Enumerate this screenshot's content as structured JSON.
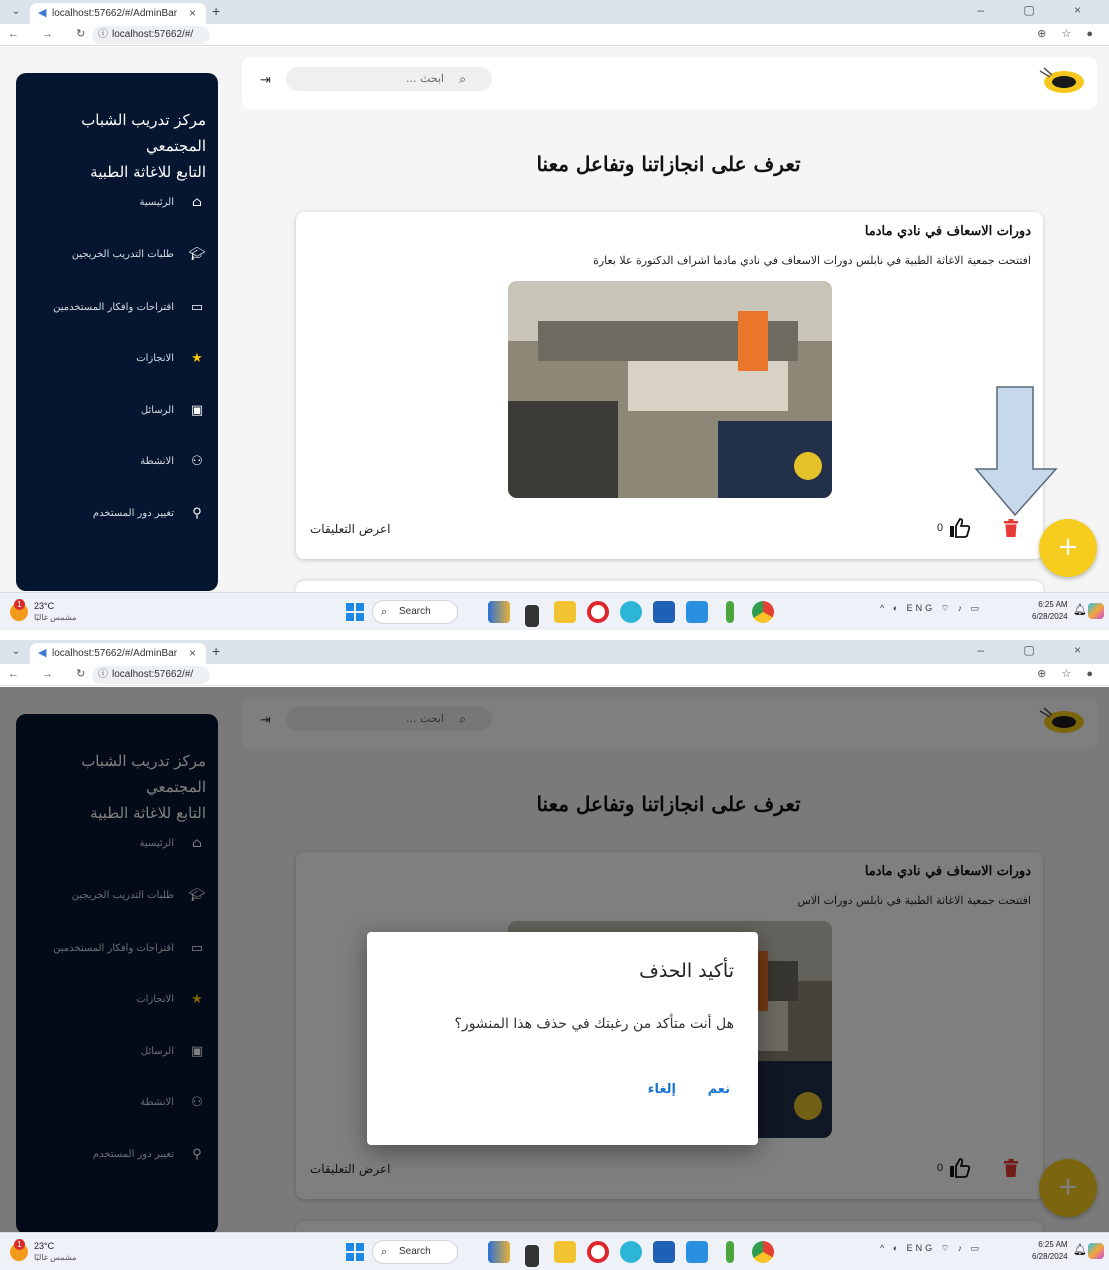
{
  "browser": {
    "tab_title_1": "localhost:57662/#/AdminBar",
    "tab_title_2": "localhost:57662/#/AdminBar",
    "url": "localhost:57662/#/"
  },
  "sidebar": {
    "brand_line1": "مركز تدريب الشباب المجتمعي",
    "brand_line2": "التابع للاغاثة الطبية",
    "items": [
      {
        "label": "الرئيسية",
        "icon": "home-icon"
      },
      {
        "label": "طلبات التدريب الخريجين",
        "icon": "graduation-cap-icon"
      },
      {
        "label": "اقتراحات وافكار المستخدمين",
        "icon": "comment-icon"
      },
      {
        "label": "الانجازات",
        "icon": "star-icon"
      },
      {
        "label": "الرسائل",
        "icon": "contact-card-icon"
      },
      {
        "label": "الانشطة",
        "icon": "group-add-icon"
      },
      {
        "label": "تغيير دور المستخدم",
        "icon": "person-add-icon"
      }
    ]
  },
  "header": {
    "search_placeholder": "ابحث ..."
  },
  "main": {
    "heading": "تعرف على انجازاتنا وتفاعل معنا",
    "post": {
      "title": "دورات الاسعاف في نادي مادما",
      "body": "افتتحت جمعية الاغاثة الطبية في نابلس  دورات الاسعاف في نادي مادما  اشراف الدكتورة علا بعارة",
      "body_partial": "افتتحت جمعية الاغاثة الطبية في نابلس  دورات الاس",
      "comments_link": "اعرض التعليقات",
      "likes": "0"
    }
  },
  "dialog": {
    "title": "تأكيد الحذف",
    "message": "هل أنت متأكد من رغبتك في حذف هذا المنشور؟",
    "confirm": "نعم",
    "cancel": "إلغاء"
  },
  "taskbar": {
    "temperature": "23°C",
    "weather": "مشمس غالبًا",
    "search": "Search",
    "language": "ENG",
    "time": "6:25 AM",
    "date": "6/28/2024"
  },
  "colors": {
    "sidebar_bg": "#061630",
    "accent_yellow": "#f6cd1e",
    "delete_red": "#e53935",
    "dialog_button": "#1976d2",
    "annotation_arrow": "#c6d9ec"
  }
}
